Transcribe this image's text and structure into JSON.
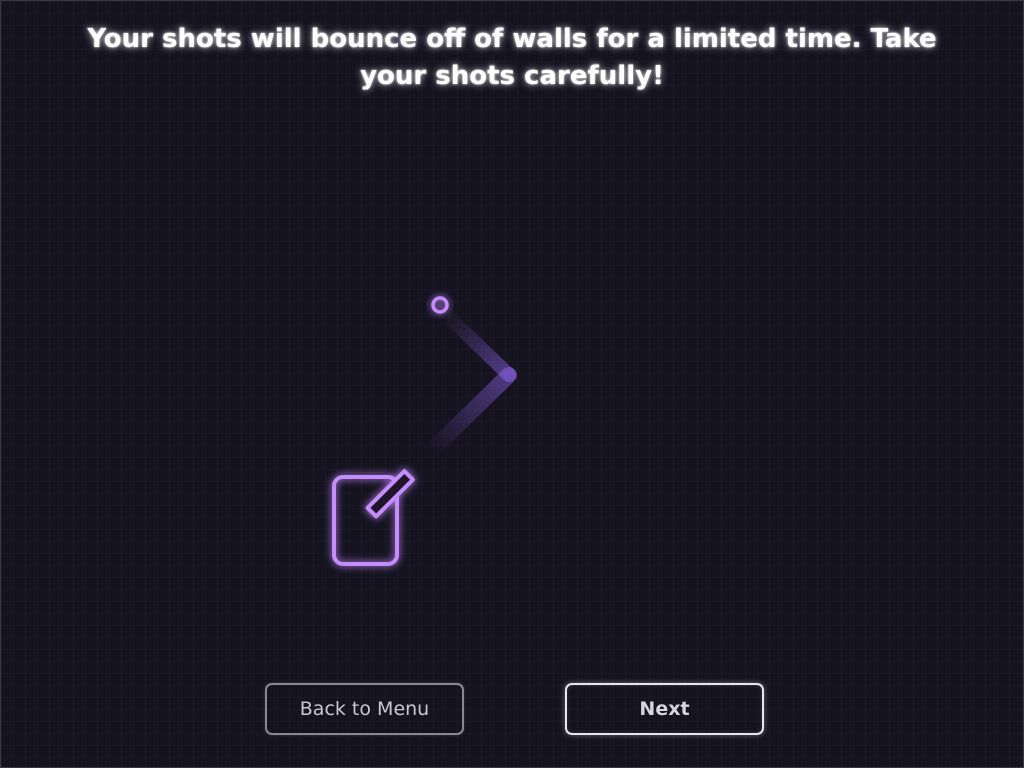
{
  "tutorial": {
    "message": "Your shots will bounce off of walls for a limited time. Take your shots carefully!"
  },
  "buttons": {
    "back_label": "Back to Menu",
    "next_label": "Next"
  },
  "colors": {
    "background": "#15131f",
    "wall": "#ffffff",
    "player_accent": "#c58cff",
    "text": "#ffffff"
  },
  "icons": {
    "player": "pencil-square-icon",
    "shot": "projectile-ring-icon"
  }
}
